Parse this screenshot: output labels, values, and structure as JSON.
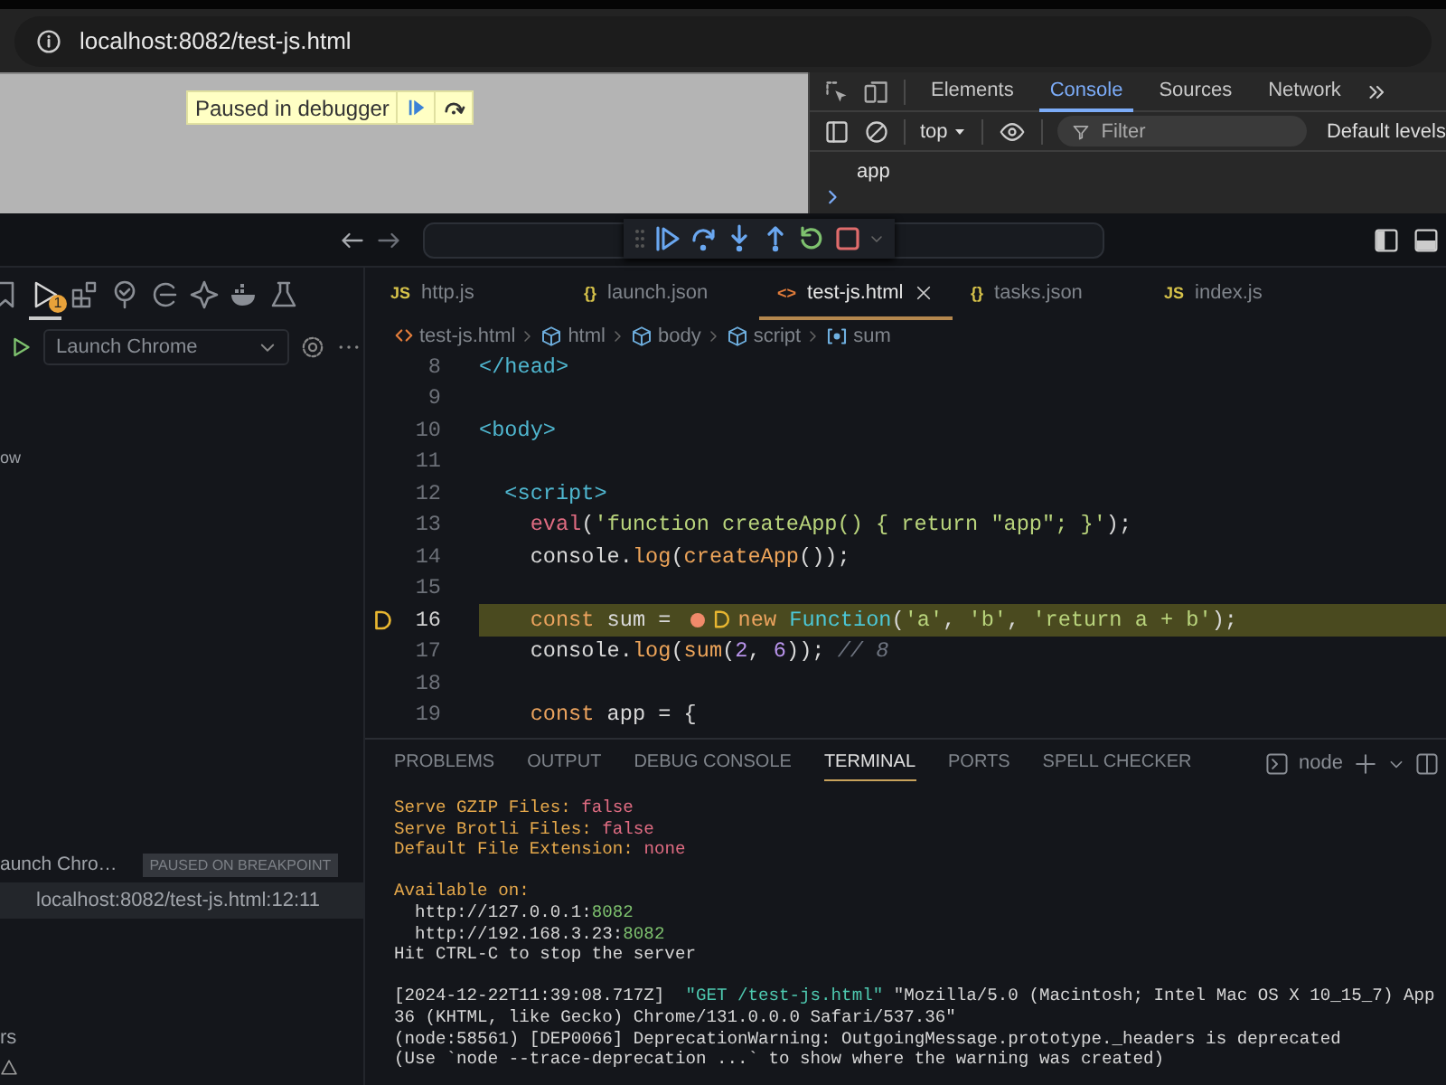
{
  "browser": {
    "url": "localhost:8082/test-js.html"
  },
  "page": {
    "banner": "Paused in debugger"
  },
  "devtools": {
    "tabs": [
      {
        "label": "Elements",
        "selected": false
      },
      {
        "label": "Console",
        "selected": true
      },
      {
        "label": "Sources",
        "selected": false
      },
      {
        "label": "Network",
        "selected": false
      }
    ],
    "toolbar": {
      "context": "top",
      "filter_placeholder": "Filter",
      "levels": "Default levels"
    },
    "console": [
      "app"
    ]
  },
  "vscode": {
    "activity_bar": [
      {
        "selected": false
      },
      {
        "selected": true,
        "badge": "1"
      },
      {
        "selected": false
      },
      {
        "selected": false
      },
      {
        "selected": false
      },
      {
        "selected": false
      },
      {
        "selected": false
      },
      {
        "selected": false
      }
    ],
    "run": {
      "config": "Launch Chrome"
    },
    "cut_label_1": "ow",
    "call_stack": {
      "session": "aunch Chro…",
      "status": "PAUSED ON BREAKPOINT",
      "frame": "localhost:8082/test-js.html:12:11"
    },
    "cut_label_2": "rs",
    "editor": {
      "tabs": [
        {
          "label": "http.js",
          "icon": "JS",
          "kind": "js",
          "selected": false
        },
        {
          "label": "launch.json",
          "icon": "{}",
          "kind": "json",
          "selected": false
        },
        {
          "label": "test-js.html",
          "icon": "<>",
          "kind": "html",
          "selected": true
        },
        {
          "label": "tasks.json",
          "icon": "{}",
          "kind": "json",
          "selected": false
        },
        {
          "label": "index.js",
          "icon": "JS",
          "kind": "js",
          "selected": false
        }
      ],
      "breadcrumb": [
        {
          "label": "test-js.html",
          "kind": "file"
        },
        {
          "label": "html",
          "kind": "element"
        },
        {
          "label": "body",
          "kind": "element"
        },
        {
          "label": "script",
          "kind": "element"
        },
        {
          "label": "sum",
          "kind": "variable"
        }
      ],
      "lines": [
        {
          "number": "8",
          "current": false,
          "tokens": [
            {
              "kind": "tag",
              "text": "</head>"
            }
          ]
        },
        {
          "number": "9",
          "current": false
        },
        {
          "number": "10",
          "current": false,
          "tokens": [
            {
              "kind": "tag",
              "text": "<body>"
            }
          ]
        },
        {
          "number": "11",
          "current": false
        },
        {
          "number": "12",
          "current": false,
          "tokens": [
            {
              "kind": "tag",
              "text": "  <script>"
            }
          ]
        },
        {
          "number": "13",
          "current": false,
          "tokens": [
            {
              "kind": "call",
              "text": "    eval"
            },
            {
              "kind": "plain",
              "text": "("
            },
            {
              "kind": "str",
              "text": "'function createApp() { return \"app\"; }'"
            },
            {
              "kind": "plain",
              "text": ");"
            }
          ]
        },
        {
          "number": "14",
          "current": false,
          "tokens": [
            {
              "kind": "plain",
              "text": "    console."
            },
            {
              "kind": "fn",
              "text": "log"
            },
            {
              "kind": "plain",
              "text": "("
            },
            {
              "kind": "fn",
              "text": "createApp"
            },
            {
              "kind": "plain",
              "text": "());"
            }
          ]
        },
        {
          "number": "15",
          "current": false
        },
        {
          "number": "16",
          "current": true,
          "tokens": [
            {
              "kind": "kw",
              "text": "    const"
            },
            {
              "kind": "plain",
              "text": " sum = "
            },
            {
              "kind": "breakpoint"
            },
            {
              "kind": "pause"
            },
            {
              "kind": "kw",
              "text": "new "
            },
            {
              "kind": "cls",
              "text": "Function"
            },
            {
              "kind": "plain",
              "text": "("
            },
            {
              "kind": "str",
              "text": "'a'"
            },
            {
              "kind": "plain",
              "text": ", "
            },
            {
              "kind": "str",
              "text": "'b'"
            },
            {
              "kind": "plain",
              "text": ", "
            },
            {
              "kind": "str",
              "text": "'return a + b'"
            },
            {
              "kind": "plain",
              "text": ");"
            }
          ]
        },
        {
          "number": "17",
          "current": false,
          "tokens": [
            {
              "kind": "plain",
              "text": "    console."
            },
            {
              "kind": "fn",
              "text": "log"
            },
            {
              "kind": "plain",
              "text": "("
            },
            {
              "kind": "fn",
              "text": "sum"
            },
            {
              "kind": "plain",
              "text": "("
            },
            {
              "kind": "num",
              "text": "2"
            },
            {
              "kind": "plain",
              "text": ", "
            },
            {
              "kind": "num",
              "text": "6"
            },
            {
              "kind": "plain",
              "text": "));"
            },
            {
              "kind": "cmt",
              "text": " // 8"
            }
          ]
        },
        {
          "number": "18",
          "current": false
        },
        {
          "number": "19",
          "current": false,
          "tokens": [
            {
              "kind": "kw",
              "text": "    const"
            },
            {
              "kind": "plain",
              "text": " app = {"
            }
          ]
        }
      ]
    },
    "panel": {
      "tabs": [
        {
          "label": "PROBLEMS",
          "selected": false
        },
        {
          "label": "OUTPUT",
          "selected": false
        },
        {
          "label": "DEBUG CONSOLE",
          "selected": false
        },
        {
          "label": "TERMINAL",
          "selected": true
        },
        {
          "label": "PORTS",
          "selected": false
        },
        {
          "label": "SPELL CHECKER",
          "selected": false
        }
      ],
      "terminal_name": "node",
      "blocks": [
        [
          [
            {
              "kind": "label",
              "text": "Serve GZIP Files: "
            },
            {
              "kind": "value",
              "text": "false"
            }
          ],
          [
            {
              "kind": "label",
              "text": "Serve Brotli Files: "
            },
            {
              "kind": "value",
              "text": "false"
            }
          ],
          [
            {
              "kind": "label",
              "text": "Default File Extension: "
            },
            {
              "kind": "value",
              "text": "none"
            }
          ]
        ],
        [
          [
            {
              "kind": "label",
              "text": "Available on:"
            }
          ],
          [
            {
              "kind": "plain",
              "text": "  http://127.0.0.1:"
            },
            {
              "kind": "port",
              "text": "8082"
            }
          ],
          [
            {
              "kind": "plain",
              "text": "  http://192.168.3.23:"
            },
            {
              "kind": "port",
              "text": "8082"
            }
          ],
          [
            {
              "kind": "plain",
              "text": "Hit CTRL-C to stop the server"
            }
          ]
        ],
        [
          [
            {
              "kind": "plain",
              "text": "[2024-12-22T11:39:08.717Z]  "
            },
            {
              "kind": "request",
              "text": "\"GET /test-js.html\""
            },
            {
              "kind": "plain",
              "text": " \"Mozilla/5.0 (Macintosh; Intel Mac OS X 10_15_7) App"
            }
          ],
          [
            {
              "kind": "plain",
              "text": "36 (KHTML, like Gecko) Chrome/131.0.0.0 Safari/537.36\""
            }
          ],
          [
            {
              "kind": "plain",
              "text": "(node:58561) [DEP0066] DeprecationWarning: OutgoingMessage.prototype._headers is deprecated"
            }
          ],
          [
            {
              "kind": "plain",
              "text": "(Use `node --trace-deprecation ...` to show where the warning was created)"
            }
          ]
        ]
      ]
    }
  }
}
